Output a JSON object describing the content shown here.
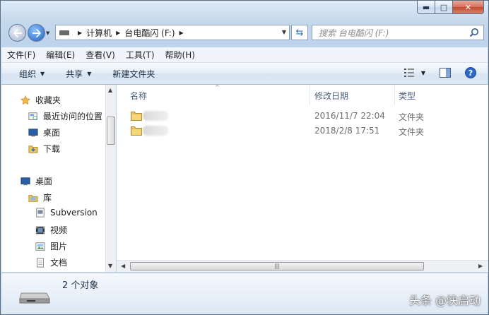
{
  "window": {
    "minimize_glyph": "▬",
    "maximize_glyph": "□",
    "close_glyph": "✕"
  },
  "address_bar": {
    "crumbs": [
      "计算机",
      "台电酷闪 (F:)"
    ],
    "search_placeholder": "搜索 台电酷闪 (F:)"
  },
  "menu": [
    "文件(F)",
    "编辑(E)",
    "查看(V)",
    "工具(T)",
    "帮助(H)"
  ],
  "toolbar": {
    "organize": "组织",
    "share": "共享",
    "new_folder": "新建文件夹"
  },
  "sidebar": {
    "favorites": "收藏夹",
    "recent": "最近访问的位置",
    "desktop_fav": "桌面",
    "downloads": "下载",
    "desktop": "桌面",
    "libraries": "库",
    "subversion": "Subversion",
    "videos": "视频",
    "pictures": "图片",
    "documents": "文档"
  },
  "columns": {
    "name": "名称",
    "date": "修改日期",
    "type": "类型"
  },
  "files": [
    {
      "date": "2016/11/7 22:04",
      "type": "文件夹"
    },
    {
      "date": "2018/2/8 17:51",
      "type": "文件夹"
    }
  ],
  "details": {
    "count": "2 个对象"
  },
  "watermark": "头条 @快启动",
  "colors": {
    "accent": "#2e6fd0",
    "folder": "#e8c25c",
    "close": "#c44a32"
  }
}
